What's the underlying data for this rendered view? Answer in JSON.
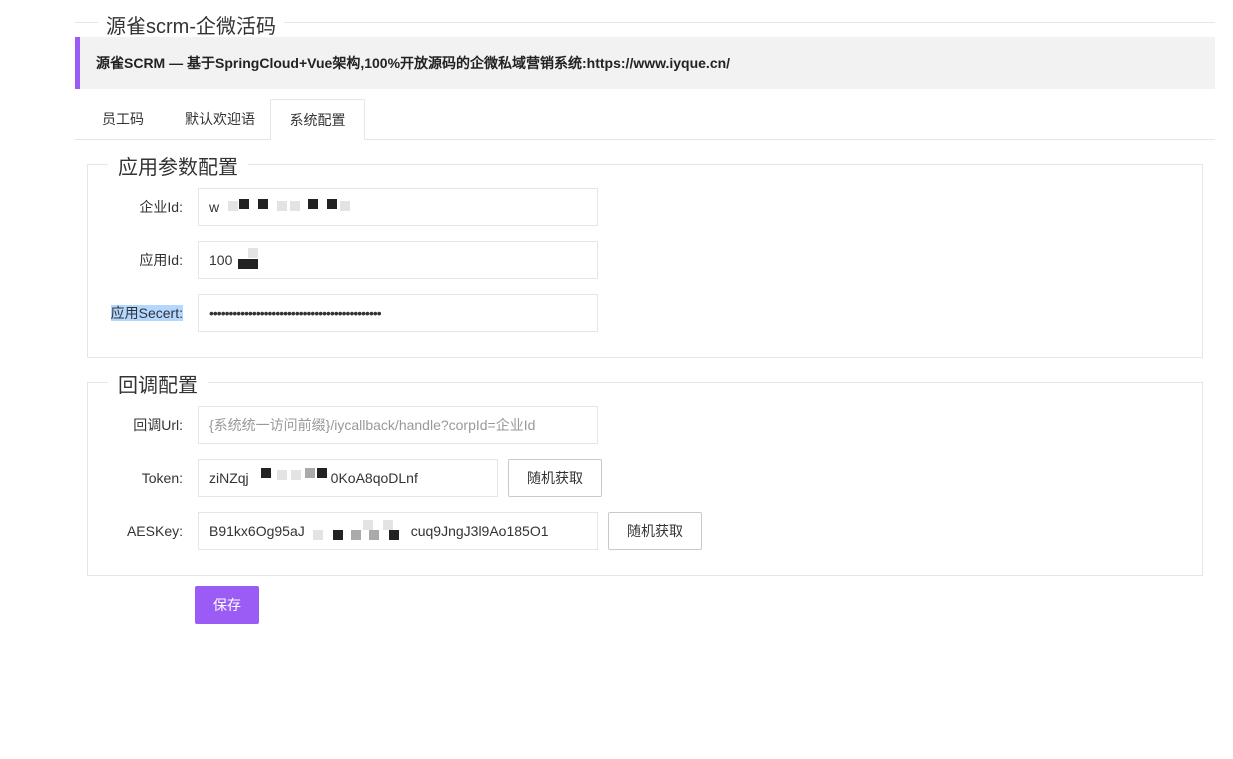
{
  "page": {
    "title": "源雀scrm-企微活码",
    "notice": "源雀SCRM — 基于SpringCloud+Vue架构,100%开放源码的企微私域营销系统:https://www.iyque.cn/"
  },
  "tabs": [
    {
      "label": "员工码"
    },
    {
      "label": "默认欢迎语"
    },
    {
      "label": "系统配置"
    }
  ],
  "app_config": {
    "legend": "应用参数配置",
    "corp_id": {
      "label": "企业Id:",
      "value": "w"
    },
    "agent_id": {
      "label": "应用Id:",
      "value": "100"
    },
    "secret": {
      "label": "应用Secert:",
      "value": "••••••••••••••••••••••••••••••••••••••••••••"
    }
  },
  "callback_config": {
    "legend": "回调配置",
    "url": {
      "label": "回调Url:",
      "placeholder": "{系统统一访问前缀}/iycallback/handle?corpId=企业Id"
    },
    "token": {
      "label": "Token:",
      "value_start": "ziNZqj",
      "value_end": "0KoA8qoDLnf",
      "button": "随机获取"
    },
    "aes_key": {
      "label": "AESKey:",
      "value_start": "B91kx6Og95aJ",
      "value_end": "cuq9JngJ3l9Ao185O1",
      "button": "随机获取"
    }
  },
  "actions": {
    "save": "保存"
  },
  "colors": {
    "accent": "#9b5cf6"
  }
}
